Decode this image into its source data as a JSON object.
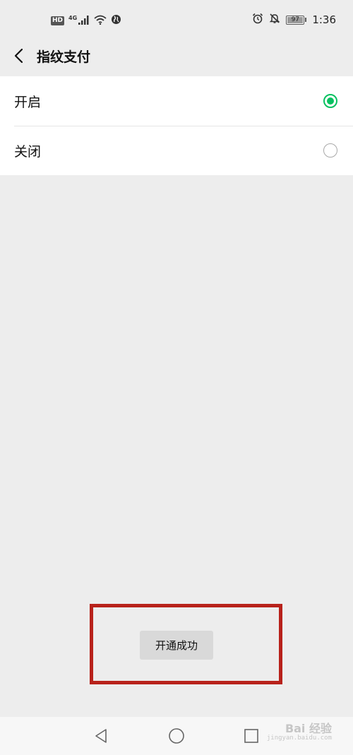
{
  "status_bar": {
    "hd_label": "HD",
    "network_label": "4G",
    "battery_level": "97",
    "time": "1:36",
    "icons": [
      "hd-icon",
      "signal-icon",
      "wifi-icon",
      "globe-icon",
      "alarm-icon",
      "mute-icon",
      "battery-icon"
    ]
  },
  "header": {
    "back_icon": "chevron-left-icon",
    "title": "指纹支付"
  },
  "options": [
    {
      "label": "开启",
      "selected": true
    },
    {
      "label": "关闭",
      "selected": false
    }
  ],
  "toast": {
    "message": "开通成功"
  },
  "system_nav": {
    "icons": [
      "nav-back-icon",
      "nav-home-icon",
      "nav-recents-icon"
    ]
  },
  "watermark": {
    "text": "Bai 经验",
    "sub": "jingyan.baidu.com"
  },
  "colors": {
    "accent": "#07c160",
    "highlight": "#b8221b",
    "background": "#ededed"
  }
}
